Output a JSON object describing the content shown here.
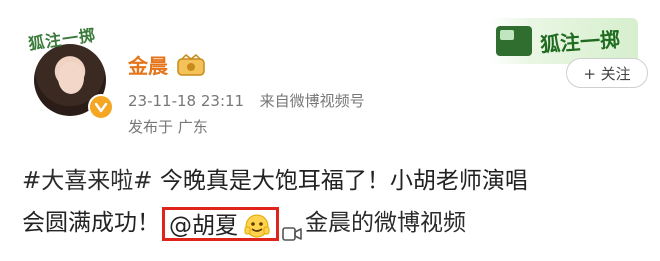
{
  "header": {
    "avatar_decoration_text": "狐注一掷",
    "name": "金晨",
    "timestamp": "23-11-18 23:11",
    "source": "来自微博视频号",
    "location": "发布于 广东",
    "follow_label": "+ 关注",
    "banner_text": "狐注一掷"
  },
  "post": {
    "line1_topic": "#大喜来啦#",
    "line1_text": " 今晚真是大饱耳福了！小胡老师演唱",
    "line2_text": "会圆满成功！",
    "mention": "@胡夏",
    "video_link": "金晨的微博视频"
  },
  "colors": {
    "name": "#e5751a",
    "highlight_box": "#e0241b",
    "meta": "#777777",
    "verified_badge": "#f5a623"
  },
  "icons": {
    "verified": "verified-badge-icon",
    "vip": "vip-crown-icon",
    "emoji": "emoji-icon",
    "video": "video-icon"
  }
}
